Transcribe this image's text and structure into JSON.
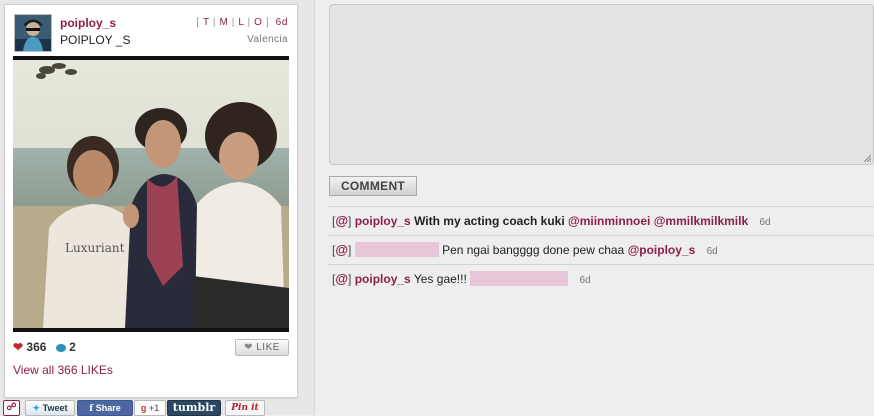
{
  "post": {
    "username": "poiploy_s",
    "full_name": "POIPLOY _S",
    "filters": [
      "T",
      "M",
      "L",
      "O"
    ],
    "age": "6d",
    "location": "Valencia",
    "likes_count": "366",
    "comments_count": "2",
    "like_button": "LIKE",
    "view_all_label": "View all 366 LIKEs"
  },
  "share_buttons": {
    "tweet": "Tweet",
    "share": "Share",
    "gplus": "+1",
    "tumblr": "tumblr",
    "pinit": "Pin it"
  },
  "comment_form": {
    "button_label": "COMMENT"
  },
  "comments": [
    {
      "at": "@",
      "user": "poiploy_s",
      "text": "With my acting coach kuki",
      "mentions": [
        "@miinminnoei",
        "@mmilkmilkmilk"
      ],
      "time": "6d"
    },
    {
      "at": "@",
      "user": "",
      "text": "Pen ngai bangggg done pew chaa",
      "mentions": [
        "@poiploy_s"
      ],
      "time": "6d"
    },
    {
      "at": "@",
      "user": "poiploy_s",
      "text": "Yes gae!!!",
      "mentions": [],
      "time": "6d"
    }
  ],
  "colors": {
    "accent": "#8d1f4c",
    "heart": "#c0262a",
    "comment_bubble": "#2a90b8",
    "redaction": "#e7c6d7",
    "page_bg": "#eeeeee"
  },
  "icons": {
    "heart": "heart-icon",
    "comment": "speech-bubble-icon",
    "like": "heart-icon",
    "share_logo": "share-logo-icon"
  }
}
